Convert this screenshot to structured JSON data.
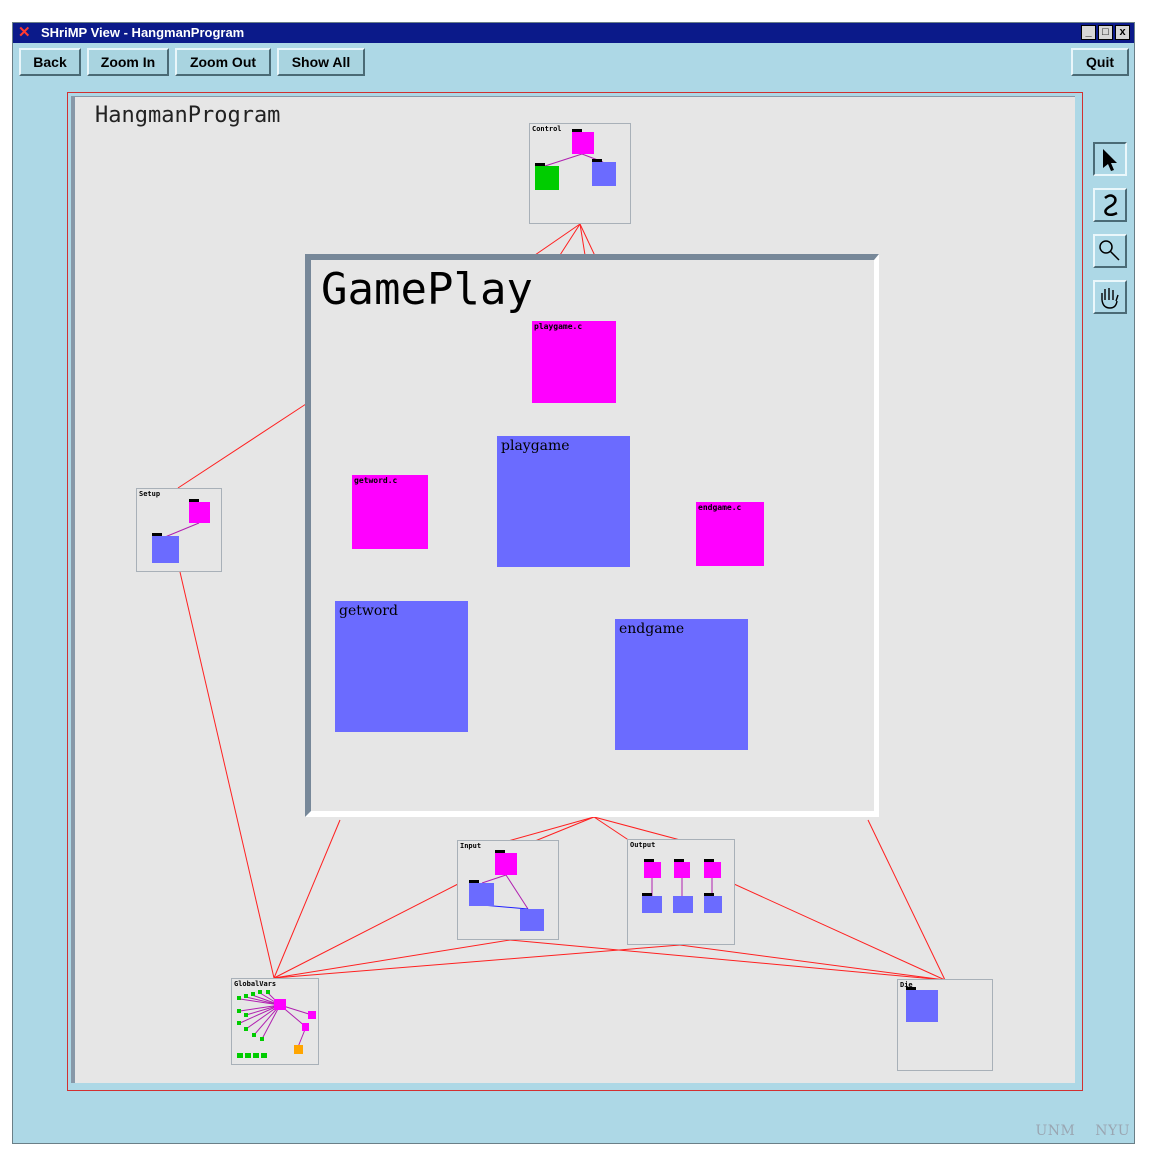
{
  "window": {
    "title": "SHriMP View - HangmanProgram",
    "controls": [
      "_",
      "□",
      "x"
    ]
  },
  "toolbar": {
    "back": "Back",
    "zoom_in": "Zoom In",
    "zoom_out": "Zoom Out",
    "show_all": "Show All",
    "quit": "Quit"
  },
  "root": {
    "label": "HangmanProgram"
  },
  "nodes": {
    "control": "Control",
    "setup": "Setup",
    "input": "Input",
    "output": "Output",
    "globalvars": "GlobalVars",
    "die": "Die"
  },
  "gameplay": {
    "title": "GamePlay",
    "playgame_c": "playgame.c",
    "playgame": "playgame",
    "getword_c": "getword.c",
    "getword": "getword",
    "endgame_c": "endgame.c",
    "endgame": "endgame"
  },
  "tools": {
    "select_icon": "select-arrow-icon",
    "link_icon": "link-squiggle-icon",
    "zoom_icon": "magnifier-icon",
    "pan_icon": "hand-pan-icon"
  },
  "footer": {
    "left": "UNM",
    "right": "NYU"
  },
  "colors": {
    "titlebar": "#0b1a8a",
    "background": "#add8e6",
    "canvas": "#e6e6e6",
    "file_node": "#ff00ff",
    "function_node": "#6b6bff",
    "edge_red": "#ff2020",
    "edge_blue": "#2020ff",
    "edge_purple": "#b020b0"
  }
}
